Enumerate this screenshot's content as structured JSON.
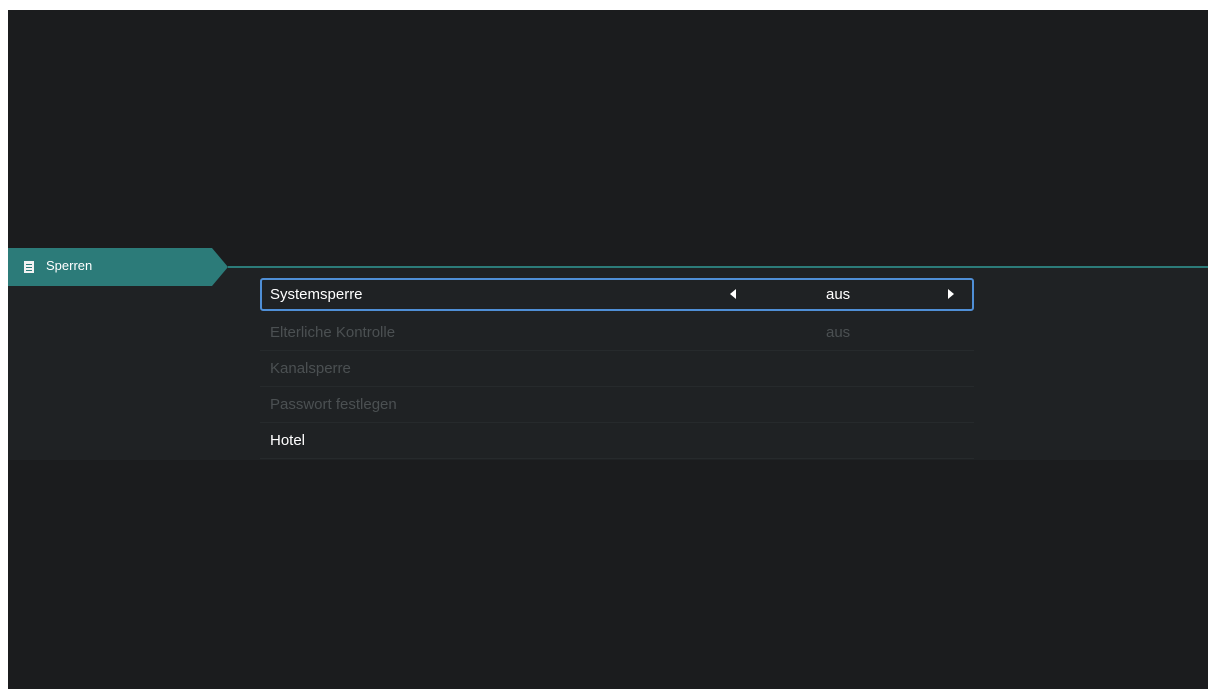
{
  "colors": {
    "background": "#1b1c1e",
    "accent": "#2c7b79",
    "focus_border": "#4f8fd6",
    "text_active": "#ffffff",
    "text_disabled": "#4b5052"
  },
  "header": {
    "tab_icon": "document-icon",
    "tab_label": "Sperren"
  },
  "menu": {
    "items": [
      {
        "label": "Systemsperre",
        "value": "aus",
        "state": "selected"
      },
      {
        "label": "Elterliche Kontrolle",
        "value": "aus",
        "state": "disabled"
      },
      {
        "label": "Kanalsperre",
        "value": "",
        "state": "disabled"
      },
      {
        "label": "Passwort festlegen",
        "value": "",
        "state": "disabled"
      },
      {
        "label": "Hotel",
        "value": "",
        "state": "enabled"
      }
    ],
    "left_arrow_icon": "arrow-left-icon",
    "right_arrow_icon": "arrow-right-icon"
  }
}
